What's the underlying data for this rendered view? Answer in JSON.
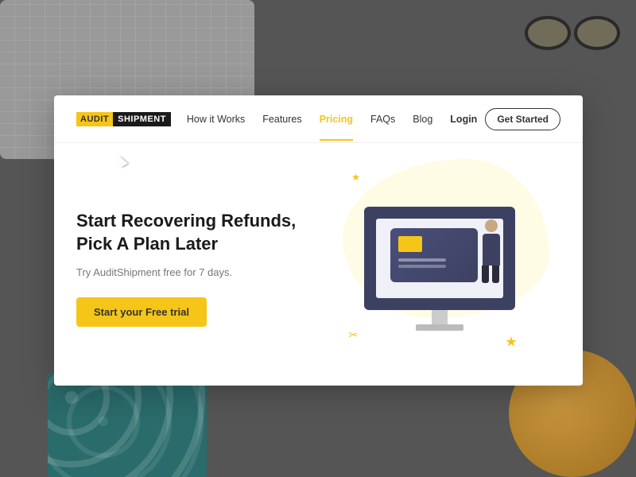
{
  "background": {
    "color": "#555555"
  },
  "navbar": {
    "logo": {
      "audit_text": "AUDIT",
      "shipment_text": "SHIPMENT"
    },
    "links": [
      {
        "label": "How it Works",
        "active": false,
        "bold": false
      },
      {
        "label": "Features",
        "active": false,
        "bold": false
      },
      {
        "label": "Pricing",
        "active": true,
        "bold": false
      },
      {
        "label": "FAQs",
        "active": false,
        "bold": false
      },
      {
        "label": "Blog",
        "active": false,
        "bold": false
      },
      {
        "label": "Login",
        "active": false,
        "bold": true
      }
    ],
    "cta_button": "Get Started"
  },
  "hero": {
    "title": "Start Recovering Refunds, Pick A Plan Later",
    "subtitle": "Try AuditShipment free for 7 days.",
    "cta_button": "Start your Free trial"
  }
}
